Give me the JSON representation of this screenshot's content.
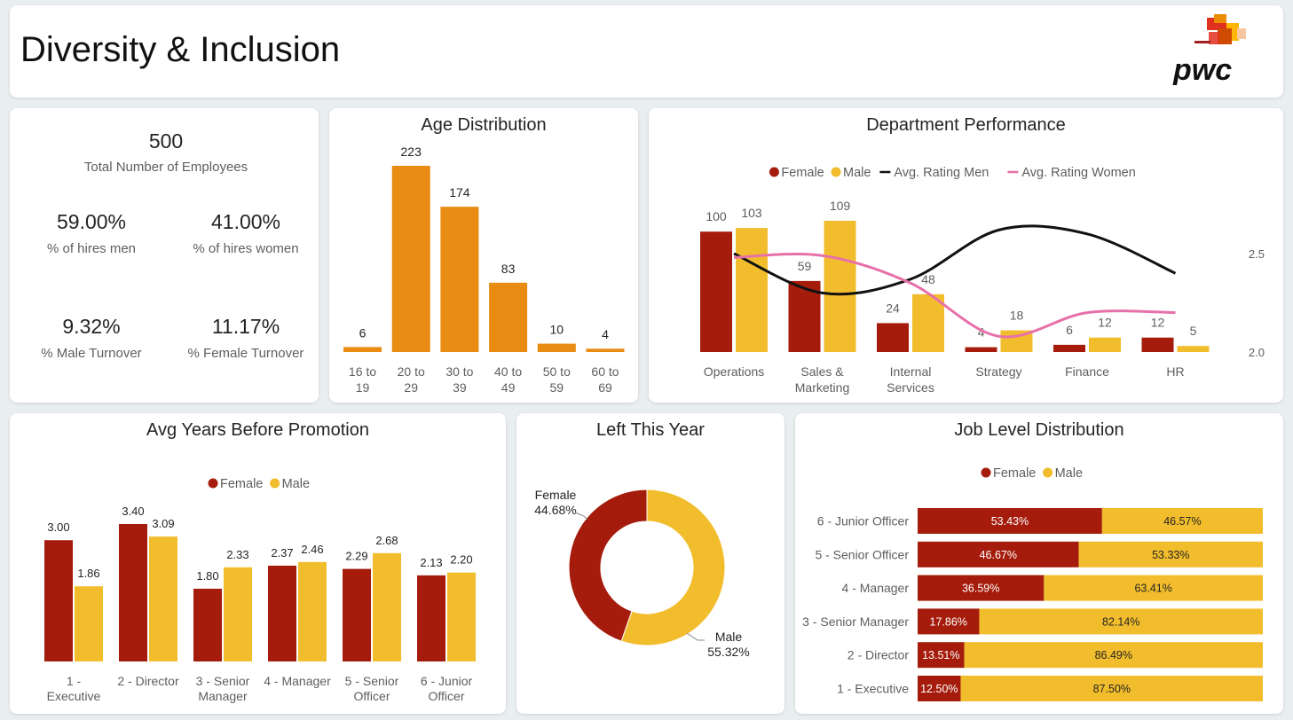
{
  "header": {
    "title": "Diversity & Inclusion",
    "logo_text": "pwc"
  },
  "kpis": {
    "total_value": "500",
    "total_label": "Total Number of Employees",
    "hires_men_value": "59.00%",
    "hires_men_label": "% of hires men",
    "hires_women_value": "41.00%",
    "hires_women_label": "% of hires women",
    "male_turnover_value": "9.32%",
    "male_turnover_label": "% Male Turnover",
    "female_turnover_value": "11.17%",
    "female_turnover_label": "% Female Turnover"
  },
  "colors": {
    "female": "#a51c0c",
    "male": "#f2bd2c",
    "age": "#e98c14",
    "men_line": "#111111",
    "women_line": "#e770a9"
  },
  "legend": {
    "female": "Female",
    "male": "Male",
    "avg_men": "Avg. Rating Men",
    "avg_women": "Avg. Rating Women"
  },
  "chart_data": [
    {
      "id": "age",
      "type": "bar",
      "title": "Age Distribution",
      "categories": [
        [
          "16 to",
          "19"
        ],
        [
          "20 to",
          "29"
        ],
        [
          "30 to",
          "39"
        ],
        [
          "40 to",
          "49"
        ],
        [
          "50 to",
          "59"
        ],
        [
          "60 to",
          "69"
        ]
      ],
      "values": [
        6,
        223,
        174,
        83,
        10,
        4
      ]
    },
    {
      "id": "dept",
      "type": "bar",
      "title": "Department Performance",
      "categories": [
        [
          "Operations"
        ],
        [
          "Sales &",
          "Marketing"
        ],
        [
          "Internal",
          "Services"
        ],
        [
          "Strategy"
        ],
        [
          "Finance"
        ],
        [
          "HR"
        ]
      ],
      "series": [
        {
          "name": "Female",
          "values": [
            100,
            59,
            24,
            4,
            6,
            12
          ]
        },
        {
          "name": "Male",
          "values": [
            103,
            109,
            48,
            18,
            12,
            5
          ]
        }
      ],
      "lines": [
        {
          "name": "Avg. Rating Men",
          "values": [
            2.5,
            2.3,
            2.37,
            2.62,
            2.6,
            2.4
          ]
        },
        {
          "name": "Avg. Rating Women",
          "values": [
            2.48,
            2.49,
            2.35,
            2.08,
            2.2,
            2.2
          ]
        }
      ],
      "y2_ticks": [
        "2.5",
        "2.0"
      ]
    },
    {
      "id": "promo",
      "type": "bar",
      "title": "Avg Years Before Promotion",
      "categories": [
        [
          "1 -",
          "Executive"
        ],
        [
          "2 - Director"
        ],
        [
          "3 - Senior",
          "Manager"
        ],
        [
          "4 - Manager"
        ],
        [
          "5 - Senior",
          "Officer"
        ],
        [
          "6 - Junior",
          "Officer"
        ]
      ],
      "series": [
        {
          "name": "Female",
          "values": [
            3.0,
            3.4,
            1.8,
            2.37,
            2.29,
            2.13
          ]
        },
        {
          "name": "Male",
          "values": [
            1.86,
            3.09,
            2.33,
            2.46,
            2.68,
            2.2
          ]
        }
      ]
    },
    {
      "id": "left",
      "type": "pie",
      "title": "Left This Year",
      "slices": [
        {
          "label": "Female",
          "percent": "44.68%",
          "value": 44.68
        },
        {
          "label": "Male",
          "percent": "55.32%",
          "value": 55.32
        }
      ]
    },
    {
      "id": "joblevel",
      "type": "bar",
      "title": "Job Level Distribution",
      "categories": [
        "6 - Junior Officer",
        "5 - Senior Officer",
        "4 - Manager",
        "3 - Senior Manager",
        "2 - Director",
        "1 - Executive"
      ],
      "series": [
        {
          "name": "Female",
          "values": [
            53.43,
            46.67,
            36.59,
            17.86,
            13.51,
            12.5
          ],
          "labels": [
            "53.43%",
            "46.67%",
            "36.59%",
            "17.86%",
            "13.51%",
            "12.50%"
          ]
        },
        {
          "name": "Male",
          "values": [
            46.57,
            53.33,
            63.41,
            82.14,
            86.49,
            87.5
          ],
          "labels": [
            "46.57%",
            "53.33%",
            "63.41%",
            "82.14%",
            "86.49%",
            "87.50%"
          ]
        }
      ]
    }
  ]
}
